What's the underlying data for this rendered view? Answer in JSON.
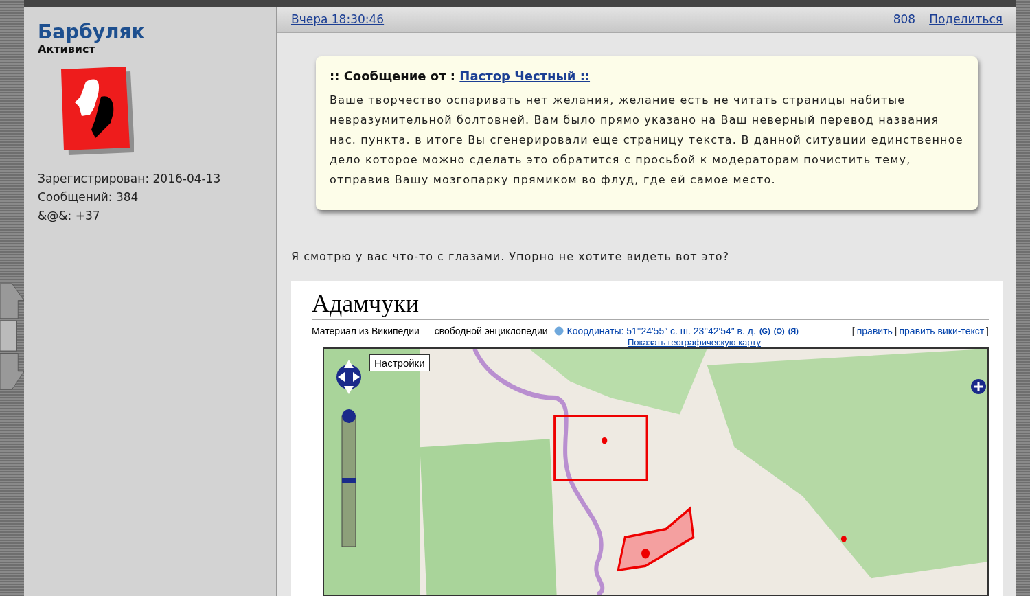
{
  "author": {
    "name": "Барбуляк",
    "rank": "Активист",
    "stats": [
      "Зарегистрирован: 2016-04-13",
      "Сообщений: 384",
      "&@&: +37"
    ]
  },
  "post": {
    "time": "Вчера 18:30:46",
    "number": "808",
    "share": "Поделиться",
    "quote": {
      "prefix": ":: Сообщение от :",
      "author": "Пастор Честный ::",
      "text": "Ваше творчество оспаривать нет желания, желание есть не читать страницы набитые невразумительной болтовней. Вам было прямо указано на Ваш неверный перевод названия нас. пункта. в итоге Вы сгенерировали еще страницу текста. В данной ситуации единственное дело которое можно сделать это обратится с просьбой к модераторам почистить тему, отправив Вашу мозгопарку прямиком во флуд, где ей самое место."
    },
    "text": "Я смотрю у вас что-то с глазами. Упорно не хотите видеть вот это?",
    "embed": {
      "title": "Адамчуки",
      "subtitle": "Материал из Википедии — свободной энциклопедии",
      "coords": "Координаты: 51°24′55″ с. ш. 23°42′54″ в. д.",
      "coord_links": [
        "(G)",
        "(O)",
        "(Я)"
      ],
      "edit_links": [
        "править",
        "править вики-текст"
      ],
      "edit_separator": "|",
      "edit_brackets": [
        "[",
        "]"
      ],
      "map_link": "Показать географическую карту",
      "map_button": "Настройки"
    }
  }
}
